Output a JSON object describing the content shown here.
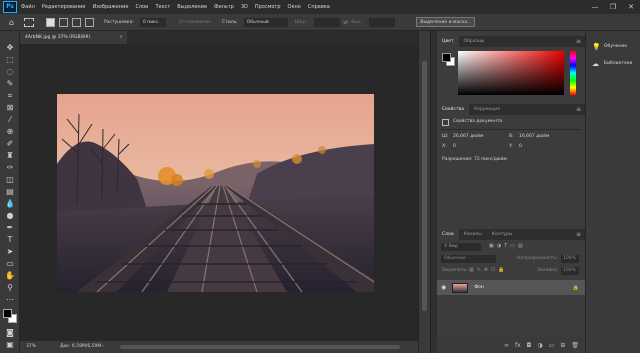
{
  "app": {
    "logo_text": "Ps",
    "brand_color": "#31a8ff"
  },
  "menu": [
    "Файл",
    "Редактирование",
    "Изображение",
    "Слои",
    "Текст",
    "Выделение",
    "Фильтр",
    "3D",
    "Просмотр",
    "Окно",
    "Справка"
  ],
  "window_controls": {
    "minimize": "—",
    "restore": "❐",
    "close": "✕"
  },
  "options_bar": {
    "feather_label": "Растушевка:",
    "feather_value": "0 пикс.",
    "antialias_label": "Сглаживание",
    "style_label": "Стиль:",
    "style_value": "Обычный",
    "width_label": "Шир.:",
    "height_label": "Выс.:",
    "select_mask_button": "Выделение и маска..."
  },
  "document": {
    "tab_title": "4ArbNK.jpg @ 37% (RGB/8#)",
    "close": "×",
    "zoom": "37%",
    "doc_size": "Док: 6,59M/6,59M"
  },
  "color_panel": {
    "tabs": [
      "Цвет",
      "Образцы"
    ],
    "foreground": "#000000",
    "background": "#ffffff"
  },
  "properties_panel": {
    "tabs": [
      "Свойства",
      "Коррекция"
    ],
    "section": "Свойства документа",
    "w_label": "Ш:",
    "w_value": "26,667 дюйм",
    "h_label": "В:",
    "h_value": "16,667 дюйм",
    "x_label": "X:",
    "x_value": "0",
    "y_label": "Y:",
    "y_value": "0",
    "resolution": "Разрешение: 72 пикс/дюйм"
  },
  "layers_panel": {
    "tabs": [
      "Слои",
      "Каналы",
      "Контуры"
    ],
    "search_placeholder": "Вид",
    "blend_mode": "Обычные",
    "opacity_label": "Непрозрачность:",
    "opacity_value": "100%",
    "lock_label": "Закрепить:",
    "fill_label": "Заливка:",
    "fill_value": "100%",
    "layer_name": "Фон"
  },
  "right_dock": {
    "learn": "Обучение",
    "libraries": "Библиотеки"
  }
}
